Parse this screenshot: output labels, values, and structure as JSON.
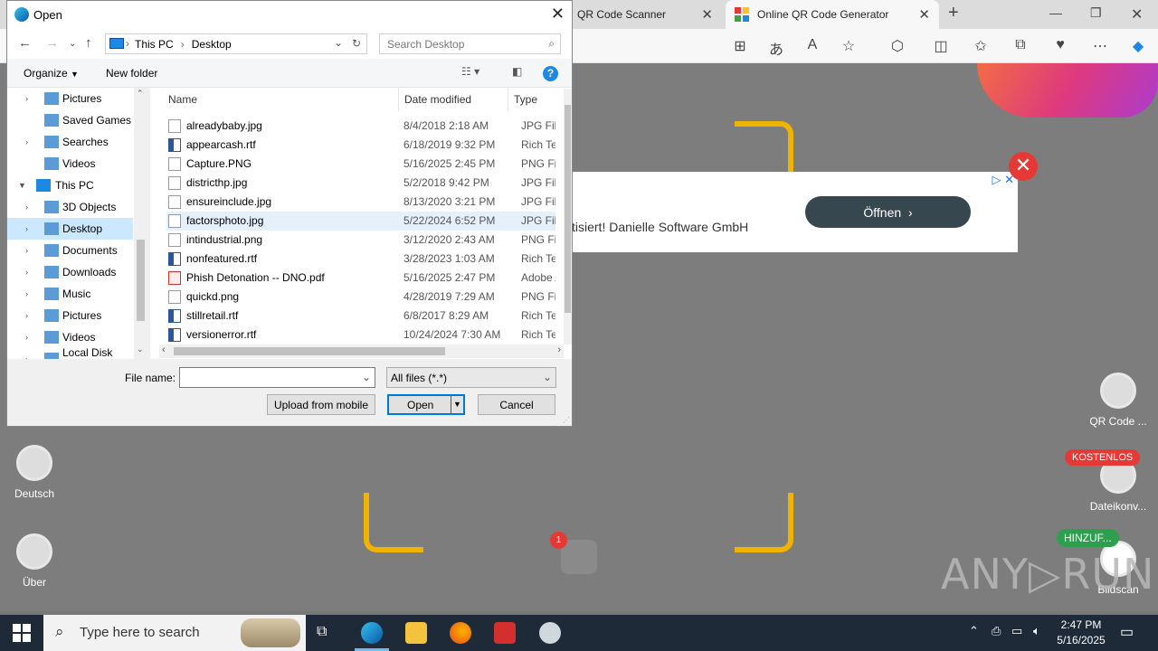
{
  "browser": {
    "tabs": [
      {
        "label": "QR Code Scanner"
      },
      {
        "label": "Online QR Code Generator"
      }
    ]
  },
  "page": {
    "ad_text": "tisiert! Danielle Software GmbH",
    "ad_button": "Öffnen",
    "side_left": [
      {
        "label": "Deutsch"
      },
      {
        "label": "Über"
      }
    ],
    "side_right": [
      {
        "label": "QR Code ..."
      },
      {
        "label": "Dateikonv..."
      },
      {
        "label": "Bildscan"
      }
    ],
    "badge_kostenlos": "KOSTENLOS",
    "badge_hinzu": "HINZUF...",
    "notification_count": "1",
    "watermark": "ANY▷RUN"
  },
  "dialog": {
    "title": "Open",
    "breadcrumb": [
      "This PC",
      "Desktop"
    ],
    "search_placeholder": "Search Desktop",
    "organize": "Organize",
    "new_folder": "New folder",
    "tree": [
      {
        "label": "Pictures",
        "icon": "pictures-icon",
        "level": 1,
        "expander": true
      },
      {
        "label": "Saved Games",
        "icon": "saved-games-icon",
        "level": 1,
        "expander": false
      },
      {
        "label": "Searches",
        "icon": "search-folder-icon",
        "level": 1,
        "expander": true
      },
      {
        "label": "Videos",
        "icon": "videos-icon",
        "level": 1,
        "expander": false
      },
      {
        "label": "This PC",
        "icon": "computer-icon",
        "level": 0,
        "expander": true
      },
      {
        "label": "3D Objects",
        "icon": "3d-objects-icon",
        "level": 1,
        "expander": true
      },
      {
        "label": "Desktop",
        "icon": "desktop-icon",
        "level": 1,
        "expander": true,
        "selected": true
      },
      {
        "label": "Documents",
        "icon": "documents-icon",
        "level": 1,
        "expander": true
      },
      {
        "label": "Downloads",
        "icon": "downloads-icon",
        "level": 1,
        "expander": true
      },
      {
        "label": "Music",
        "icon": "music-icon",
        "level": 1,
        "expander": true
      },
      {
        "label": "Pictures",
        "icon": "pictures-icon",
        "level": 1,
        "expander": true
      },
      {
        "label": "Videos",
        "icon": "videos-icon",
        "level": 1,
        "expander": true
      },
      {
        "label": "Local Disk (C:)",
        "icon": "disk-icon",
        "level": 1,
        "expander": true
      }
    ],
    "columns": {
      "name": "Name",
      "date": "Date modified",
      "type": "Type"
    },
    "files": [
      {
        "name": "alreadybaby.jpg",
        "date": "8/4/2018 2:18 AM",
        "type": "JPG File",
        "icon": "image-file-icon"
      },
      {
        "name": "appearcash.rtf",
        "date": "6/18/2019 9:32 PM",
        "type": "Rich Text",
        "icon": "word-file-icon"
      },
      {
        "name": "Capture.PNG",
        "date": "5/16/2025 2:45 PM",
        "type": "PNG File",
        "icon": "image-file-icon"
      },
      {
        "name": "districthp.jpg",
        "date": "5/2/2018 9:42 PM",
        "type": "JPG File",
        "icon": "image-file-icon"
      },
      {
        "name": "ensureinclude.jpg",
        "date": "8/13/2020 3:21 PM",
        "type": "JPG File",
        "icon": "image-file-icon"
      },
      {
        "name": "factorsphoto.jpg",
        "date": "5/22/2024 6:52 PM",
        "type": "JPG File",
        "icon": "image-file-icon",
        "selected": true
      },
      {
        "name": "intindustrial.png",
        "date": "3/12/2020 2:43 AM",
        "type": "PNG File",
        "icon": "image-file-icon"
      },
      {
        "name": "nonfeatured.rtf",
        "date": "3/28/2023 1:03 AM",
        "type": "Rich Text",
        "icon": "word-file-icon"
      },
      {
        "name": "Phish Detonation -- DNO.pdf",
        "date": "5/16/2025 2:47 PM",
        "type": "Adobe Ac",
        "icon": "pdf-file-icon"
      },
      {
        "name": "quickd.png",
        "date": "4/28/2019 7:29 AM",
        "type": "PNG File",
        "icon": "image-file-icon"
      },
      {
        "name": "stillretail.rtf",
        "date": "6/8/2017 8:29 AM",
        "type": "Rich Text",
        "icon": "word-file-icon"
      },
      {
        "name": "versionerror.rtf",
        "date": "10/24/2024 7:30 AM",
        "type": "Rich Text",
        "icon": "word-file-icon"
      }
    ],
    "file_name_label": "File name:",
    "file_name_value": "",
    "filter": "All files (*.*)",
    "upload_button": "Upload from mobile",
    "open_button": "Open",
    "cancel_button": "Cancel"
  },
  "taskbar": {
    "search_placeholder": "Type here to search",
    "time": "2:47 PM",
    "date": "5/16/2025"
  }
}
